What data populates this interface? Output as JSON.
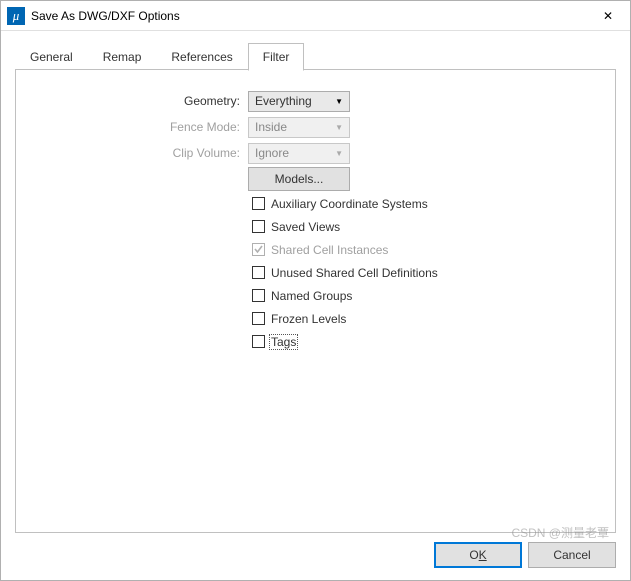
{
  "window": {
    "title": "Save As DWG/DXF Options"
  },
  "tabs": {
    "general": "General",
    "remap": "Remap",
    "references": "References",
    "filter": "Filter",
    "active": "filter"
  },
  "form": {
    "geometry": {
      "label": "Geometry:",
      "value": "Everything",
      "enabled": true
    },
    "fenceMode": {
      "label": "Fence Mode:",
      "value": "Inside",
      "enabled": false
    },
    "clipVolume": {
      "label": "Clip Volume:",
      "value": "Ignore",
      "enabled": false
    },
    "modelsBtn": "Models..."
  },
  "checks": {
    "aux": {
      "label": "Auxiliary Coordinate Systems",
      "checked": false,
      "enabled": true
    },
    "saved": {
      "label": "Saved Views",
      "checked": false,
      "enabled": true
    },
    "shared": {
      "label": "Shared Cell Instances",
      "checked": true,
      "enabled": false
    },
    "unused": {
      "label": "Unused Shared Cell Definitions",
      "checked": false,
      "enabled": true
    },
    "named": {
      "label": "Named Groups",
      "checked": false,
      "enabled": true
    },
    "frozen": {
      "label": "Frozen Levels",
      "checked": false,
      "enabled": true
    },
    "tags": {
      "label": "Tags",
      "checked": false,
      "enabled": true,
      "focused": true
    }
  },
  "buttons": {
    "ok_prefix": "O",
    "ok_key": "K",
    "cancel": "Cancel"
  },
  "watermark": "CSDN @测量老覃"
}
